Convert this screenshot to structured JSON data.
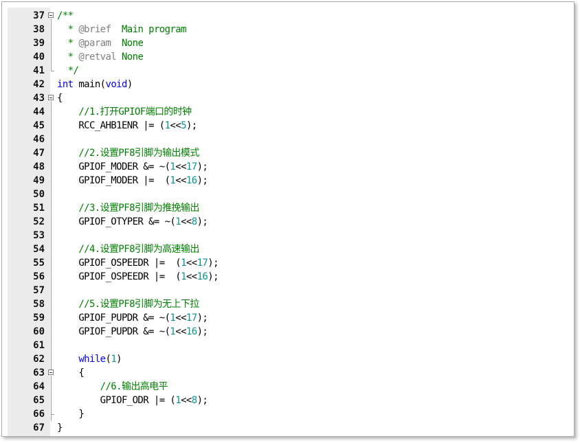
{
  "colors": {
    "keyword": "#0000ff",
    "number": "#0a9494",
    "comment": "#008000",
    "doc_tag": "#808080",
    "default": "#000000",
    "gutter": "#ececec"
  },
  "lines": [
    {
      "n": "37",
      "fold": "open",
      "tokens": [
        {
          "t": "/**",
          "c": "cm"
        }
      ]
    },
    {
      "n": "38",
      "fold": "line",
      "tokens": [
        {
          "t": "  * ",
          "c": "cm"
        },
        {
          "t": "@brief",
          "c": "tag"
        },
        {
          "t": "  Main program",
          "c": "cm"
        }
      ]
    },
    {
      "n": "39",
      "fold": "line",
      "tokens": [
        {
          "t": "  * ",
          "c": "cm"
        },
        {
          "t": "@param",
          "c": "tag"
        },
        {
          "t": "  None",
          "c": "cm"
        }
      ]
    },
    {
      "n": "40",
      "fold": "line",
      "tokens": [
        {
          "t": "  * ",
          "c": "cm"
        },
        {
          "t": "@retval",
          "c": "tag"
        },
        {
          "t": " None",
          "c": "cm"
        }
      ]
    },
    {
      "n": "41",
      "fold": "end",
      "tokens": [
        {
          "t": "  */",
          "c": "cm"
        }
      ]
    },
    {
      "n": "42",
      "fold": "",
      "tokens": [
        {
          "t": "int",
          "c": "kw"
        },
        {
          "t": " main(",
          "c": ""
        },
        {
          "t": "void",
          "c": "kw"
        },
        {
          "t": ")",
          "c": ""
        }
      ]
    },
    {
      "n": "43",
      "fold": "open",
      "tokens": [
        {
          "t": "{",
          "c": ""
        }
      ]
    },
    {
      "n": "44",
      "fold": "line",
      "tokens": [
        {
          "t": "    //1.打开GPIOF端口的时钟",
          "c": "cm"
        }
      ]
    },
    {
      "n": "45",
      "fold": "line",
      "tokens": [
        {
          "t": "    RCC_AHB1ENR |= (",
          "c": ""
        },
        {
          "t": "1",
          "c": "num"
        },
        {
          "t": "<<",
          "c": ""
        },
        {
          "t": "5",
          "c": "num"
        },
        {
          "t": ");",
          "c": ""
        }
      ]
    },
    {
      "n": "46",
      "fold": "line",
      "tokens": []
    },
    {
      "n": "47",
      "fold": "line",
      "tokens": [
        {
          "t": "    //2.设置PF8引脚为输出模式",
          "c": "cm"
        }
      ]
    },
    {
      "n": "48",
      "fold": "line",
      "tokens": [
        {
          "t": "    GPIOF_MODER &= ~(",
          "c": ""
        },
        {
          "t": "1",
          "c": "num"
        },
        {
          "t": "<<",
          "c": ""
        },
        {
          "t": "17",
          "c": "num"
        },
        {
          "t": ");",
          "c": ""
        }
      ]
    },
    {
      "n": "49",
      "fold": "line",
      "tokens": [
        {
          "t": "    GPIOF_MODER |=  (",
          "c": ""
        },
        {
          "t": "1",
          "c": "num"
        },
        {
          "t": "<<",
          "c": ""
        },
        {
          "t": "16",
          "c": "num"
        },
        {
          "t": ");",
          "c": ""
        }
      ]
    },
    {
      "n": "50",
      "fold": "line",
      "tokens": []
    },
    {
      "n": "51",
      "fold": "line",
      "tokens": [
        {
          "t": "    //3.设置PF8引脚为推挽输出",
          "c": "cm"
        }
      ]
    },
    {
      "n": "52",
      "fold": "line",
      "tokens": [
        {
          "t": "    GPIOF_OTYPER &= ~(",
          "c": ""
        },
        {
          "t": "1",
          "c": "num"
        },
        {
          "t": "<<",
          "c": ""
        },
        {
          "t": "8",
          "c": "num"
        },
        {
          "t": ");",
          "c": ""
        }
      ]
    },
    {
      "n": "53",
      "fold": "line",
      "tokens": []
    },
    {
      "n": "54",
      "fold": "line",
      "tokens": [
        {
          "t": "    //4.设置PF8引脚为高速输出",
          "c": "cm"
        }
      ]
    },
    {
      "n": "55",
      "fold": "line",
      "tokens": [
        {
          "t": "    GPIOF_OSPEEDR |=  (",
          "c": ""
        },
        {
          "t": "1",
          "c": "num"
        },
        {
          "t": "<<",
          "c": ""
        },
        {
          "t": "17",
          "c": "num"
        },
        {
          "t": ");",
          "c": ""
        }
      ]
    },
    {
      "n": "56",
      "fold": "line",
      "tokens": [
        {
          "t": "    GPIOF_OSPEEDR |=  (",
          "c": ""
        },
        {
          "t": "1",
          "c": "num"
        },
        {
          "t": "<<",
          "c": ""
        },
        {
          "t": "16",
          "c": "num"
        },
        {
          "t": ");",
          "c": ""
        }
      ]
    },
    {
      "n": "57",
      "fold": "line",
      "tokens": []
    },
    {
      "n": "58",
      "fold": "line",
      "tokens": [
        {
          "t": "    //5.设置PF8引脚为无上下拉",
          "c": "cm"
        }
      ]
    },
    {
      "n": "59",
      "fold": "line",
      "tokens": [
        {
          "t": "    GPIOF_PUPDR &= ~(",
          "c": ""
        },
        {
          "t": "1",
          "c": "num"
        },
        {
          "t": "<<",
          "c": ""
        },
        {
          "t": "17",
          "c": "num"
        },
        {
          "t": ");",
          "c": ""
        }
      ]
    },
    {
      "n": "60",
      "fold": "line",
      "tokens": [
        {
          "t": "    GPIOF_PUPDR &= ~(",
          "c": ""
        },
        {
          "t": "1",
          "c": "num"
        },
        {
          "t": "<<",
          "c": ""
        },
        {
          "t": "16",
          "c": "num"
        },
        {
          "t": ");",
          "c": ""
        }
      ]
    },
    {
      "n": "61",
      "fold": "line",
      "tokens": []
    },
    {
      "n": "62",
      "fold": "line",
      "tokens": [
        {
          "t": "    ",
          "c": ""
        },
        {
          "t": "while",
          "c": "kw"
        },
        {
          "t": "(",
          "c": ""
        },
        {
          "t": "1",
          "c": "num"
        },
        {
          "t": ")",
          "c": ""
        }
      ]
    },
    {
      "n": "63",
      "fold": "open",
      "tokens": [
        {
          "t": "    {",
          "c": ""
        }
      ]
    },
    {
      "n": "64",
      "fold": "line",
      "tokens": [
        {
          "t": "        //6.输出高电平",
          "c": "cm"
        }
      ]
    },
    {
      "n": "65",
      "fold": "line",
      "tokens": [
        {
          "t": "        GPIOF_ODR |= (",
          "c": ""
        },
        {
          "t": "1",
          "c": "num"
        },
        {
          "t": "<<",
          "c": ""
        },
        {
          "t": "8",
          "c": "num"
        },
        {
          "t": ");",
          "c": ""
        }
      ]
    },
    {
      "n": "66",
      "fold": "end",
      "tokens": [
        {
          "t": "    }",
          "c": ""
        }
      ]
    },
    {
      "n": "67",
      "fold": "",
      "tokens": [
        {
          "t": "}",
          "c": ""
        }
      ]
    }
  ]
}
